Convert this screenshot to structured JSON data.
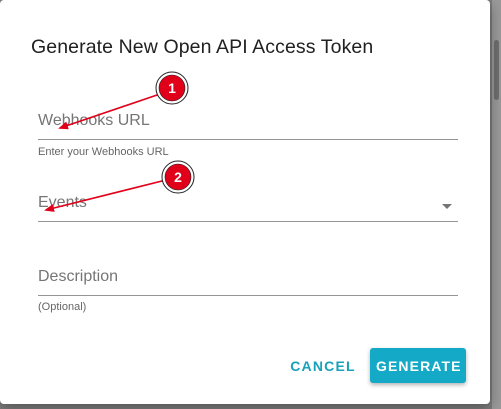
{
  "dialog": {
    "title": "Generate New Open API Access Token"
  },
  "fields": {
    "webhooks": {
      "label": "Webhooks URL",
      "helper": "Enter your Webhooks URL"
    },
    "events": {
      "label": "Events"
    },
    "description": {
      "label": "Description",
      "helper": "(Optional)"
    }
  },
  "actions": {
    "cancel_label": "CANCEL",
    "generate_label": "GENERATE"
  },
  "annotations": [
    {
      "number": "1"
    },
    {
      "number": "2"
    }
  ],
  "colors": {
    "accent": "#14a9c6",
    "annotation_red": "#e0001a"
  }
}
